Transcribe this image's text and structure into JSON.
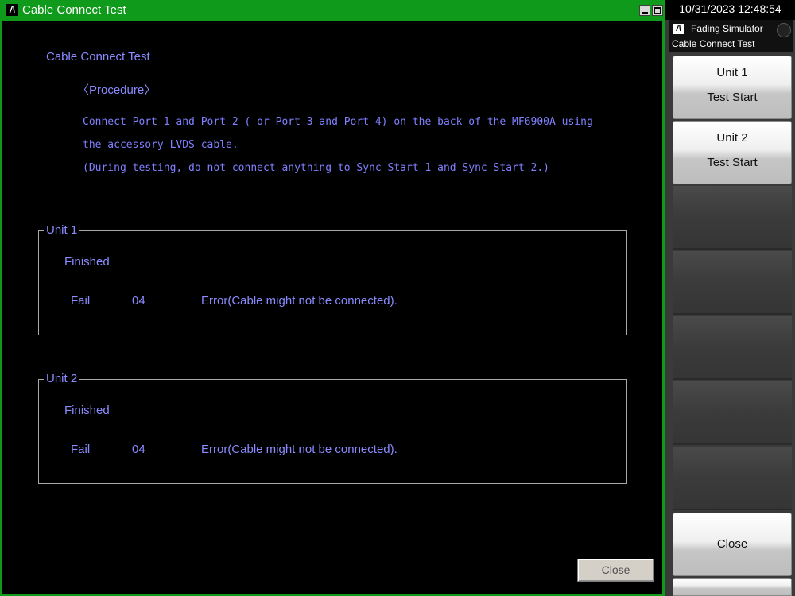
{
  "dialog": {
    "title": "Cable Connect Test",
    "heading": "Cable Connect Test",
    "procedure_label": "〈Procedure〉",
    "instructions": [
      "Connect Port 1 and Port 2 ( or Port 3 and Port 4) on the back of the MF6900A using",
      "the accessory LVDS cable.",
      "(During testing, do not connect anything to Sync Start 1 and Sync Start 2.)"
    ],
    "units": [
      {
        "legend": "Unit 1",
        "status": "Finished",
        "result": "Fail",
        "code": "04",
        "message": "Error(Cable might not be connected)."
      },
      {
        "legend": "Unit 2",
        "status": "Finished",
        "result": "Fail",
        "code": "04",
        "message": "Error(Cable might not be connected)."
      }
    ],
    "close_label": "Close"
  },
  "panel": {
    "datetime": "10/31/2023 12:48:54",
    "app_name": "Fading Simulator",
    "screen_name": "Cable Connect Test",
    "softkeys": [
      {
        "line1": "Unit 1",
        "line2": "Test Start"
      },
      {
        "line1": "Unit 2",
        "line2": "Test Start"
      }
    ],
    "close_label": "Close"
  },
  "icons": {
    "logo": "anritsu-logo-icon"
  },
  "colors": {
    "title_bar": "#0f9a1c",
    "text": "#8b8bff",
    "background": "#000000"
  }
}
